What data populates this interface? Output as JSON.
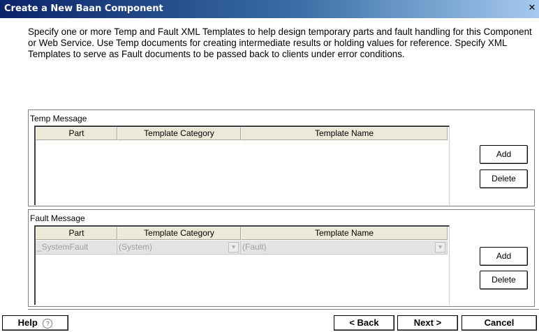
{
  "window": {
    "title": "Create a New Baan Component",
    "close_glyph": "✕"
  },
  "intro_text": "Specify one or more Temp and Fault XML Templates to help design temporary parts and fault handling for this Component or Web Service.  Use Temp documents for creating intermediate results or holding values for reference. Specify XML Templates to serve as Fault documents to be passed back to clients under error conditions.",
  "temp_message": {
    "legend": "Temp Message",
    "columns": [
      "Part",
      "Template Category",
      "Template Name"
    ],
    "rows": [],
    "add_label": "Add",
    "delete_label": "Delete"
  },
  "fault_message": {
    "legend": "Fault Message",
    "columns": [
      "Part",
      "Template Category",
      "Template Name"
    ],
    "rows": [
      {
        "part": "_SystemFault",
        "category": "(System)",
        "name": "(Fault)"
      }
    ],
    "add_label": "Add",
    "delete_label": "Delete"
  },
  "footer": {
    "help_label": "Help",
    "help_icon": "help-circle-icon",
    "back_label": "< Back",
    "next_label": "Next >",
    "cancel_label": "Cancel"
  }
}
